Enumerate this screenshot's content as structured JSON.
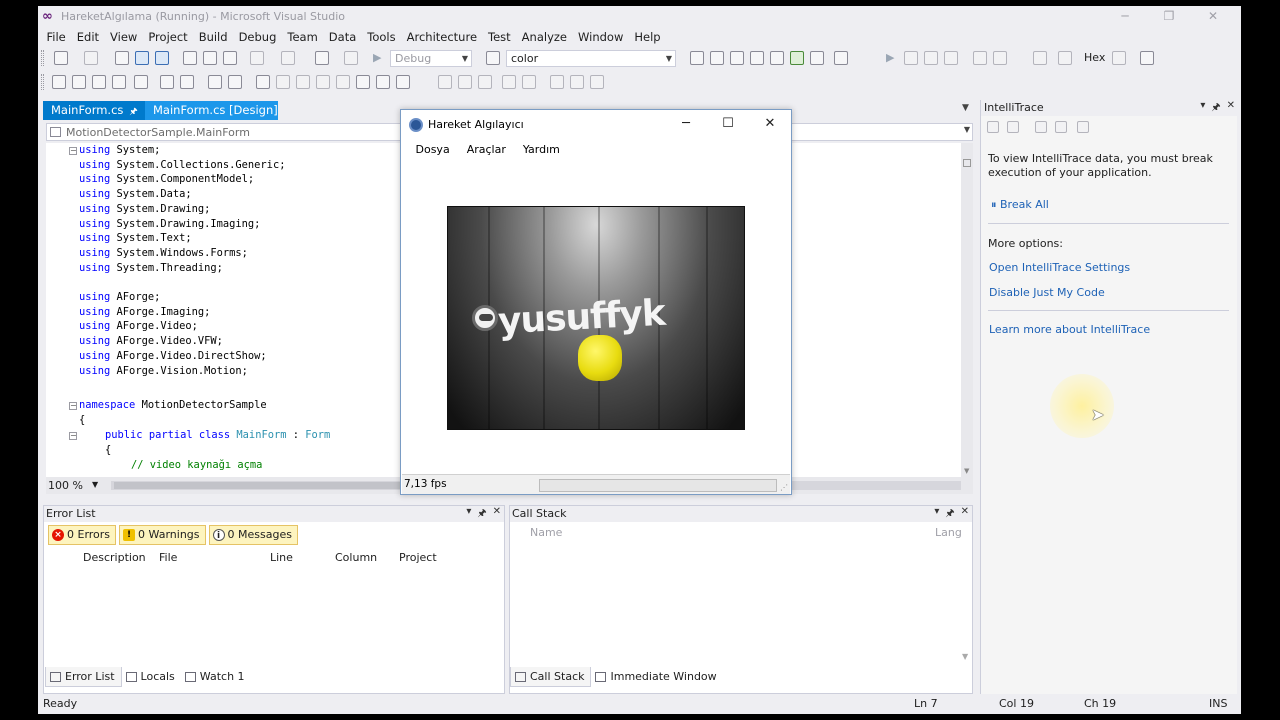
{
  "window": {
    "title": "HareketAlgılama (Running) - Microsoft Visual Studio",
    "controls": [
      "─",
      "❐",
      "✕"
    ]
  },
  "menu": [
    "File",
    "Edit",
    "View",
    "Project",
    "Build",
    "Debug",
    "Team",
    "Data",
    "Tools",
    "Architecture",
    "Test",
    "Analyze",
    "Window",
    "Help"
  ],
  "toolbar": {
    "config": "Debug",
    "search": "color",
    "hex": "Hex"
  },
  "tabs": [
    {
      "label": "MainForm.cs",
      "pin": "🖈",
      "close": "✕"
    },
    {
      "label": "MainForm.cs [Design]",
      "pin": "🖈"
    }
  ],
  "nav": {
    "type": "MotionDetectorSample.MainForm"
  },
  "code": {
    "using_system": [
      "using",
      "System;"
    ],
    "lines": [
      "System.Collections.Generic;",
      "System.ComponentModel;",
      "System.Data;",
      "System.Drawing;",
      "System.Drawing.Imaging;",
      "System.Text;",
      "System.Windows.Forms;",
      "System.Threading;"
    ],
    "aforge": [
      "AForge;",
      "AForge.Imaging;",
      "AForge.Video;",
      "AForge.Video.VFW;",
      "AForge.Video.DirectShow;",
      "AForge.Vision.Motion;"
    ],
    "kw_using": "using",
    "kw_namespace": "namespace",
    "namespace": "MotionDetectorSample",
    "brace": "{",
    "kw_public": "public",
    "kw_partial": "partial",
    "kw_class": "class",
    "class_name": "MainForm",
    "colon": ":",
    "base": "Form",
    "comment": "// video kaynağı açma"
  },
  "editor": {
    "zoom": "100 %"
  },
  "form": {
    "title": "Hareket Algılayıcı",
    "menu": [
      "Dosya",
      "Araçlar",
      "Yardım"
    ],
    "video_text": "yusuffyk",
    "fps": "7,13 fps",
    "controls": [
      "─",
      "☐",
      "✕"
    ]
  },
  "intellitrace": {
    "title": "IntelliTrace",
    "message": "To view IntelliTrace data, you must break execution of your application.",
    "break_all": "Break All",
    "more_options": "More options:",
    "open_settings": "Open IntelliTrace Settings",
    "disable_jmc": "Disable Just My Code",
    "learn_more": "Learn more about IntelliTrace"
  },
  "error_list": {
    "title": "Error List",
    "errors": "0 Errors",
    "warnings": "0 Warnings",
    "messages": "0 Messages",
    "columns": [
      "Description",
      "File",
      "Line",
      "Column",
      "Project"
    ]
  },
  "call_stack": {
    "title": "Call Stack",
    "columns": [
      "Name",
      "Lang"
    ]
  },
  "bottom_tabs_left": [
    "Error List",
    "Locals",
    "Watch 1"
  ],
  "bottom_tabs_right": [
    "Call Stack",
    "Immediate Window"
  ],
  "panel_controls": [
    "▾",
    "🖈",
    "✕"
  ],
  "status": {
    "ready": "Ready",
    "ln": "Ln 7",
    "col": "Col 19",
    "ch": "Ch 19",
    "ins": "INS"
  }
}
